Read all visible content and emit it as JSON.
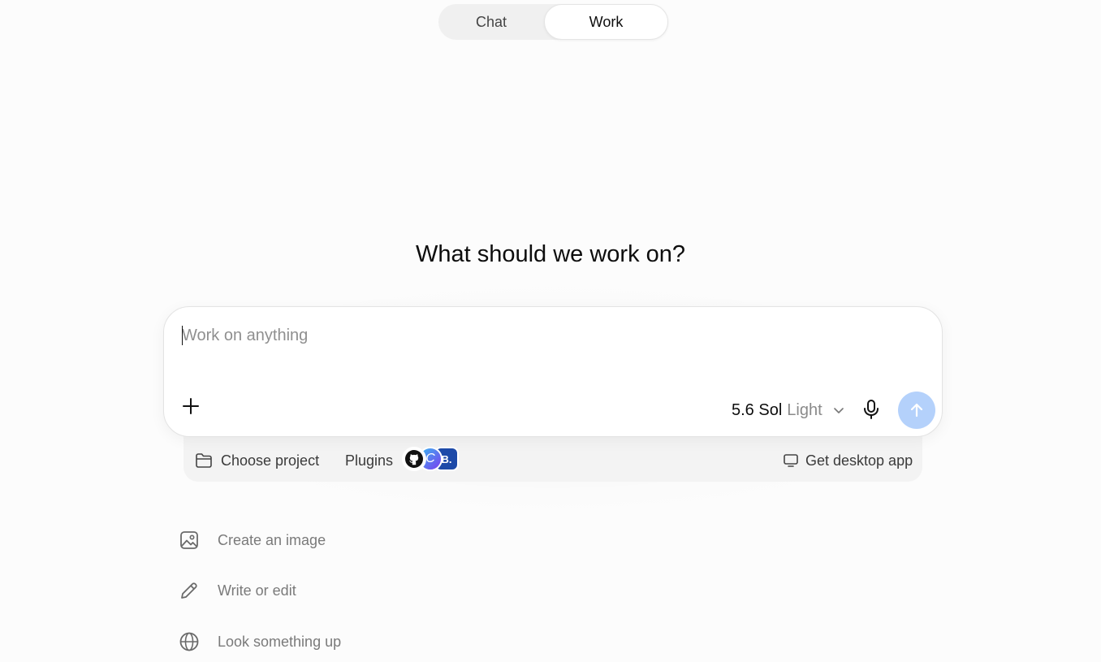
{
  "mode_toggle": {
    "chat_label": "Chat",
    "work_label": "Work",
    "active": "Work"
  },
  "headline": "What should we work on?",
  "composer": {
    "placeholder": "Work on anything",
    "value": "",
    "model": {
      "name": "5.6 Sol",
      "variant": "Light"
    },
    "send_color": "#b4d1fb"
  },
  "tray": {
    "project_label": "Choose project",
    "plugins_label": "Plugins",
    "plugin_badges": [
      "github-icon",
      "c-icon",
      "B."
    ],
    "desktop_label": "Get desktop app"
  },
  "suggestions": [
    {
      "label": "Create an image",
      "icon": "image-icon"
    },
    {
      "label": "Write or edit",
      "icon": "pencil-icon"
    },
    {
      "label": "Look something up",
      "icon": "globe-icon"
    }
  ]
}
